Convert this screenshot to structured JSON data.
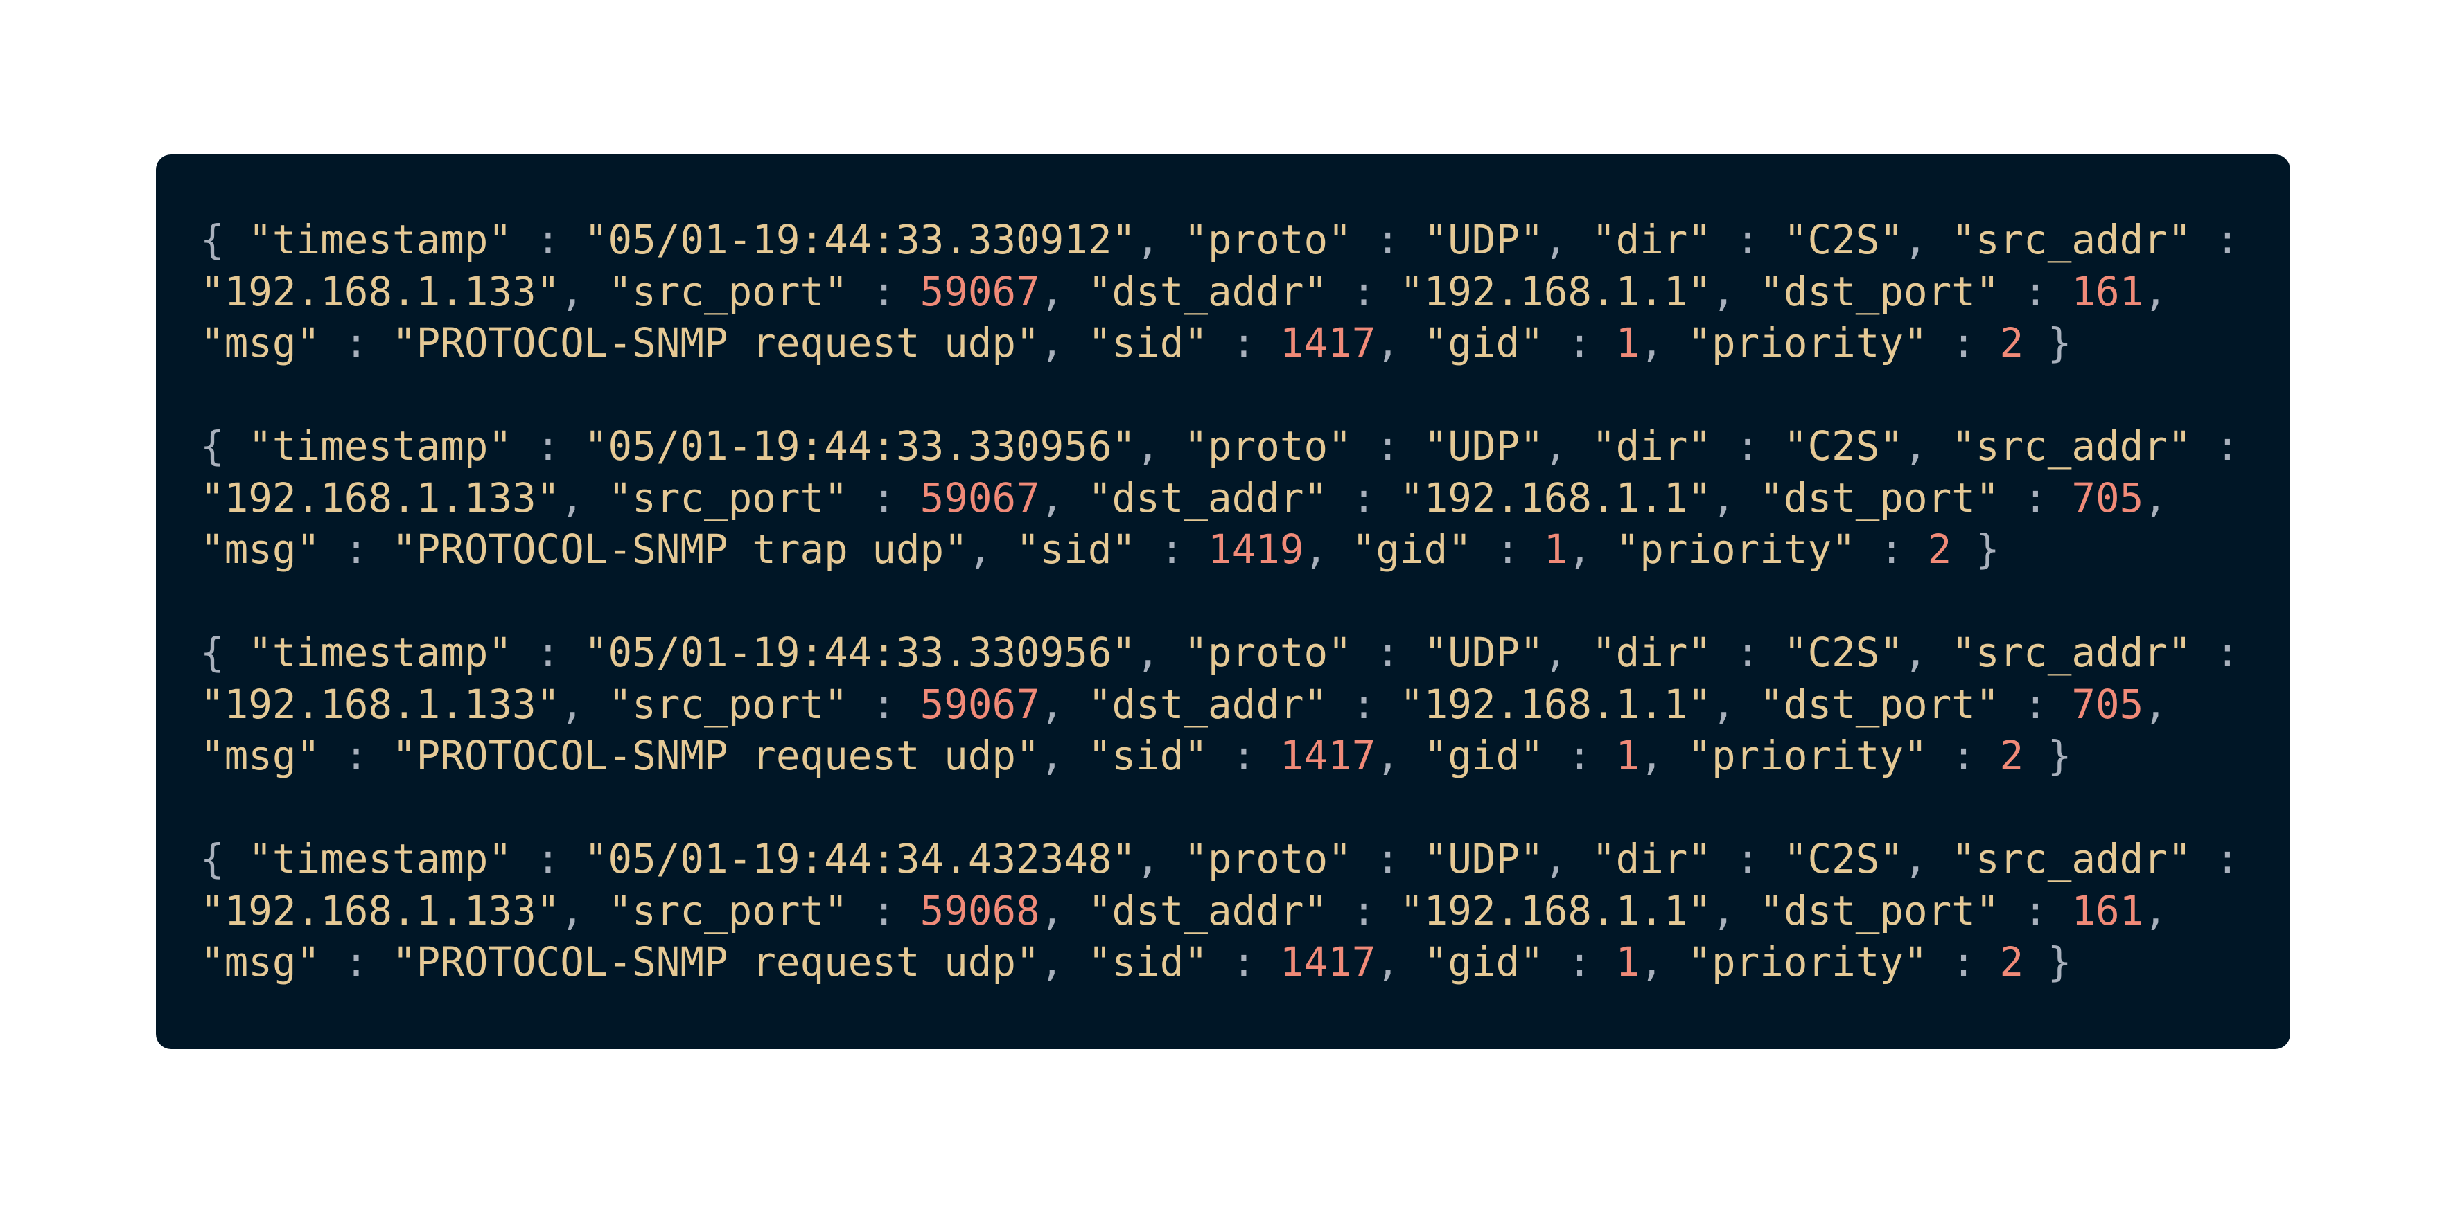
{
  "colors": {
    "background": "#ffffff",
    "panel": "#001626",
    "string": "#e5c995",
    "number": "#f08a78",
    "punctuation": "#a8b0bc"
  },
  "entries": [
    {
      "timestamp": "05/01-19:44:33.330912",
      "proto": "UDP",
      "dir": "C2S",
      "src_addr": "192.168.1.133",
      "src_port": "59067",
      "dst_addr": "192.168.1.1",
      "dst_port": "161",
      "msg": "PROTOCOL-SNMP request udp",
      "sid": "1417",
      "gid": "1",
      "priority": "2"
    },
    {
      "timestamp": "05/01-19:44:33.330956",
      "proto": "UDP",
      "dir": "C2S",
      "src_addr": "192.168.1.133",
      "src_port": "59067",
      "dst_addr": "192.168.1.1",
      "dst_port": "705",
      "msg": "PROTOCOL-SNMP trap udp",
      "sid": "1419",
      "gid": "1",
      "priority": "2"
    },
    {
      "timestamp": "05/01-19:44:33.330956",
      "proto": "UDP",
      "dir": "C2S",
      "src_addr": "192.168.1.133",
      "src_port": "59067",
      "dst_addr": "192.168.1.1",
      "dst_port": "705",
      "msg": "PROTOCOL-SNMP request udp",
      "sid": "1417",
      "gid": "1",
      "priority": "2"
    },
    {
      "timestamp": "05/01-19:44:34.432348",
      "proto": "UDP",
      "dir": "C2S",
      "src_addr": "192.168.1.133",
      "src_port": "59068",
      "dst_addr": "192.168.1.1",
      "dst_port": "161",
      "msg": "PROTOCOL-SNMP request udp",
      "sid": "1417",
      "gid": "1",
      "priority": "2"
    }
  ]
}
